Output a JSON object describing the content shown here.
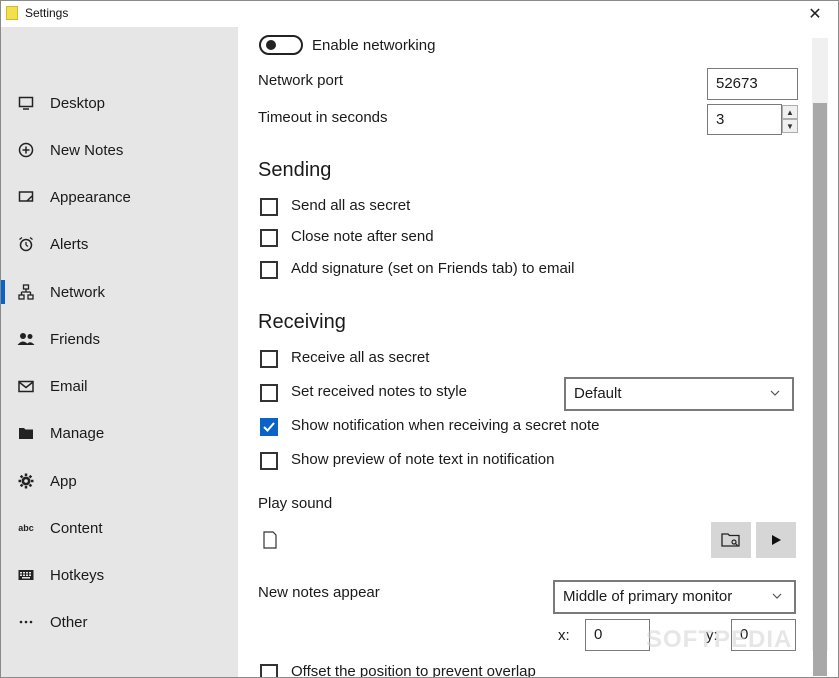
{
  "window": {
    "title": "Settings",
    "close_glyph": "✕"
  },
  "sidebar": {
    "items": [
      {
        "label": "Desktop",
        "icon": "monitor-icon"
      },
      {
        "label": "New Notes",
        "icon": "plus-circle-icon"
      },
      {
        "label": "Appearance",
        "icon": "palette-icon"
      },
      {
        "label": "Alerts",
        "icon": "alarm-icon"
      },
      {
        "label": "Network",
        "icon": "network-icon",
        "active": true
      },
      {
        "label": "Friends",
        "icon": "people-icon"
      },
      {
        "label": "Email",
        "icon": "mail-icon"
      },
      {
        "label": "Manage",
        "icon": "folder-icon"
      },
      {
        "label": "App",
        "icon": "gear-icon"
      },
      {
        "label": "Content",
        "icon": "abc-icon"
      },
      {
        "label": "Hotkeys",
        "icon": "keyboard-icon"
      },
      {
        "label": "Other",
        "icon": "ellipsis-icon"
      }
    ]
  },
  "network": {
    "enable_label": "Enable networking",
    "port_label": "Network port",
    "port_value": "52673",
    "timeout_label": "Timeout in seconds",
    "timeout_value": "3"
  },
  "sending": {
    "heading": "Sending",
    "options": [
      {
        "label": "Send all as secret",
        "checked": false
      },
      {
        "label": "Close note after send",
        "checked": false
      },
      {
        "label": "Add signature (set on Friends tab) to email",
        "checked": false
      }
    ]
  },
  "receiving": {
    "heading": "Receiving",
    "options": [
      {
        "label": "Receive all as secret",
        "checked": false
      },
      {
        "label": "Set received notes to style",
        "checked": false
      },
      {
        "label": "Show notification when receiving a secret note",
        "checked": true
      },
      {
        "label": "Show preview of note text in notification",
        "checked": false
      }
    ],
    "style_select_value": "Default",
    "play_sound_label": "Play sound",
    "new_notes_label": "New notes appear",
    "position_select_value": "Middle of primary monitor",
    "x_label": "x:",
    "x_value": "0",
    "y_label": "y:",
    "y_value": "0",
    "offset_label": "Offset the position to prevent overlap"
  },
  "watermark": "SOFTPEDIA",
  "colors": {
    "accent": "#0a64c8",
    "sidebar_bg": "#e6e6e6"
  }
}
